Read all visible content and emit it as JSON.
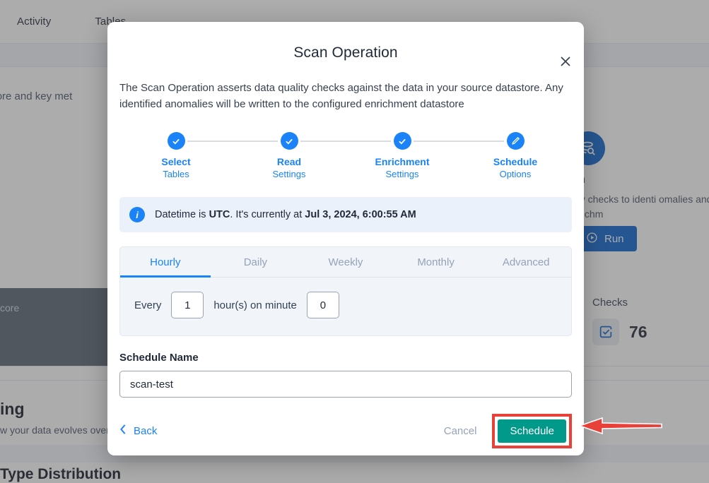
{
  "background": {
    "tabs": [
      "Activity",
      "Tables"
    ],
    "subtitle_text": "uality Score and key met",
    "scan_card": {
      "icon": "scan-search-icon",
      "title": "an",
      "description": "sert quality checks to identi omalies and record enrichm",
      "run_label": "Run"
    },
    "dark_card_text": "core",
    "checks": {
      "label": "Checks",
      "icon": "check-square-icon",
      "value": "76"
    },
    "section_title": "ing",
    "section_subtitle": "w your data evolves over",
    "section_title_2": "Type Distribution"
  },
  "modal": {
    "close_icon": "close-icon",
    "title": "Scan Operation",
    "description": "The Scan Operation asserts data quality checks against the data in your source datastore. Any identified anomalies will be written to the configured enrichment datastore",
    "stepper": [
      {
        "label": "Select",
        "sub": "Tables",
        "icon": "check-icon",
        "state": "complete"
      },
      {
        "label": "Read",
        "sub": "Settings",
        "icon": "check-icon",
        "state": "complete"
      },
      {
        "label": "Enrichment",
        "sub": "Settings",
        "icon": "check-icon",
        "state": "complete"
      },
      {
        "label": "Schedule",
        "sub": "Options",
        "icon": "pencil-icon",
        "state": "current"
      }
    ],
    "info_banner": {
      "icon": "info-icon",
      "prefix": "Datetime is ",
      "timezone": "UTC",
      "middle": ". It's currently at ",
      "datetime": "Jul 3, 2024, 6:00:55 AM"
    },
    "schedule_tabs": [
      {
        "label": "Hourly",
        "active": true
      },
      {
        "label": "Daily",
        "active": false
      },
      {
        "label": "Weekly",
        "active": false
      },
      {
        "label": "Monthly",
        "active": false
      },
      {
        "label": "Advanced",
        "active": false
      }
    ],
    "hourly": {
      "every_label": "Every",
      "hours_value": "1",
      "between_label": "hour(s) on minute",
      "minute_value": "0"
    },
    "schedule_name": {
      "label": "Schedule Name",
      "value": "scan-test",
      "placeholder": "Schedule Name"
    },
    "footer": {
      "back_label": "Back",
      "back_icon": "chevron-left-icon",
      "cancel_label": "Cancel",
      "submit_label": "Schedule"
    }
  },
  "annotation": {
    "highlight_color": "#e8413a",
    "arrow": "left-pointing-arrow"
  },
  "colors": {
    "primary_blue": "#1a83f7",
    "run_blue": "#0b63ce",
    "teal": "#00998a",
    "annotation_red": "#e8413a",
    "info_bg": "#eaf1fb",
    "panel_bg": "#f1f5f9"
  }
}
